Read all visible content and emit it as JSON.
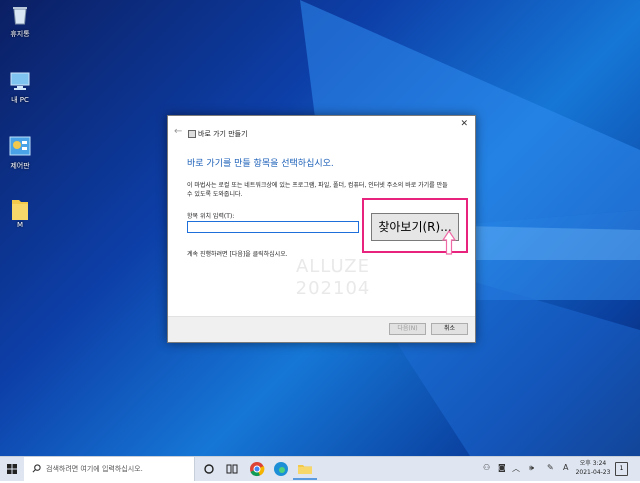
{
  "desktop": {
    "icons": [
      {
        "label": "휴지통",
        "icon": "recycle-bin-icon"
      },
      {
        "label": "내 PC",
        "icon": "this-pc-icon"
      },
      {
        "label": "제어판",
        "icon": "control-panel-icon"
      },
      {
        "label": "M",
        "icon": "folder-icon"
      }
    ]
  },
  "dialog": {
    "window_title": "바로 가기 만들기",
    "heading": "바로 가기를 만들 항목을 선택하십시오.",
    "description": "이 마법사는 로컬 또는 네트워크상에 있는 프로그램, 파일, 폴더, 컴퓨터, 인터넷 주소의 바로 가기를 만들 수 있도록 도와줍니다.",
    "field_label": "항목 위치 입력(T):",
    "location_value": "",
    "continue_text": "계속 진행하려면 [다음]을 클릭하십시오.",
    "watermark_line1": "ALLUZE",
    "watermark_line2": "202104",
    "next_label": "다음(N)",
    "cancel_label": "취소",
    "close_glyph": "✕",
    "back_glyph": "←"
  },
  "browse_button": {
    "label": "찾아보기(R)..."
  },
  "colors": {
    "heading": "#1b5fb8",
    "highlight": "#e8237d",
    "cursor": "#f06aa8"
  },
  "taskbar": {
    "search_placeholder": "검색하려면 여기에 입력하십시오.",
    "apps": [
      "cortana-icon",
      "task-view-icon",
      "chrome-icon",
      "edge-icon",
      "file-explorer-icon"
    ],
    "ime": "A",
    "time": "오후 3:24",
    "date": "2021-04-23",
    "notification_count": "1"
  }
}
